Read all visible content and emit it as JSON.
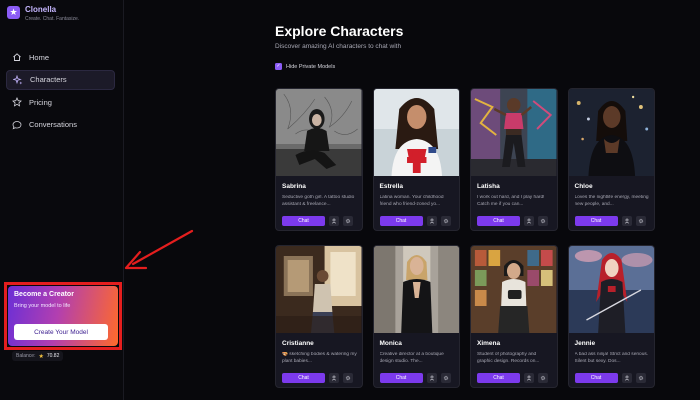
{
  "brand": {
    "name": "Clonella",
    "tagline": "Create. Chat. Fantasize.",
    "logo_icon": "star-icon",
    "accent": "#8b5cf6"
  },
  "nav": [
    {
      "label": "Home",
      "icon": "home-icon",
      "active": false
    },
    {
      "label": "Characters",
      "icon": "sparkles-icon",
      "active": true
    },
    {
      "label": "Pricing",
      "icon": "star-outline-icon",
      "active": false
    },
    {
      "label": "Conversations",
      "icon": "chat-bubble-icon",
      "active": false
    }
  ],
  "creator": {
    "title": "Become a Creator",
    "subtitle": "Bring your model to life",
    "button": "Create Your Model"
  },
  "balance": {
    "label": "Balance:",
    "value": "70.82"
  },
  "main": {
    "title": "Explore Characters",
    "subtitle": "Discover amazing AI characters to chat with",
    "filter_label": "Hide Private Models",
    "filter_checked": true
  },
  "chat_label": "Chat",
  "characters": [
    {
      "name": "Sabrina",
      "desc": "Seductive goth girl. A tattoo studio assistant & freelance..."
    },
    {
      "name": "Estrella",
      "desc": "Latina woman. Your childhood friend who friend-zoned yo..."
    },
    {
      "name": "Latisha",
      "desc": "I work out hard, and I play hard! Catch me if you can..."
    },
    {
      "name": "Chloe",
      "desc": "Loves the nightlife energy, meeting new people, and..."
    },
    {
      "name": "Cristianne",
      "desc": "🎨 sketching bodies & watering my plant babies..."
    },
    {
      "name": "Monica",
      "desc": "Creative director at a boutique design studio. The..."
    },
    {
      "name": "Ximena",
      "desc": "Student of photography and graphic design. Records on..."
    },
    {
      "name": "Jennie",
      "desc": "A bad ass ninja! Strict and serious. Silent but sexy. Dos..."
    }
  ]
}
